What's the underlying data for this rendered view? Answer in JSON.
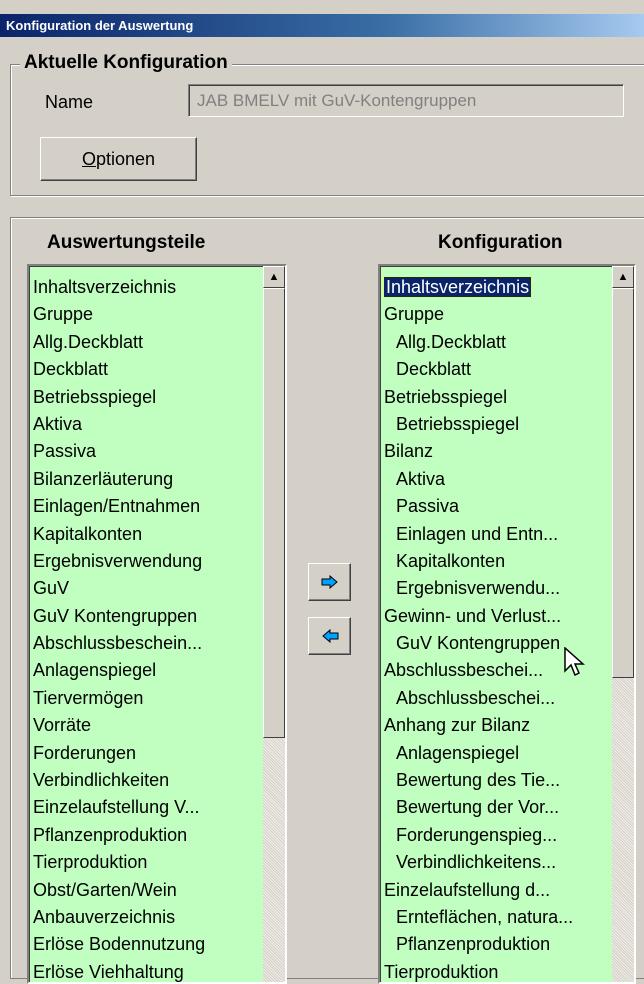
{
  "window": {
    "title": "Konfiguration der Auswertung"
  },
  "current_config": {
    "group_label": "Aktuelle Konfiguration",
    "name_label": "Name",
    "name_value": "JAB BMELV mit  GuV-Kontengruppen",
    "options_button_first": "O",
    "options_button_rest": "ptionen"
  },
  "left_list": {
    "header": "Auswertungsteile",
    "items": [
      "Inhaltsverzeichnis",
      "Gruppe",
      "Allg.Deckblatt",
      "Deckblatt",
      "Betriebsspiegel",
      "Aktiva",
      "Passiva",
      "Bilanzerläuterung",
      "Einlagen/Entnahmen",
      "Kapitalkonten",
      "Ergebnisverwendung",
      "GuV",
      "GuV Kontengruppen",
      "Abschlussbeschein...",
      "Anlagenspiegel",
      "Tiervermögen",
      "Vorräte",
      "Forderungen",
      "Verbindlichkeiten",
      "Einzelaufstellung V...",
      "Pflanzenproduktion",
      "Tierproduktion",
      "Obst/Garten/Wein",
      "Anbauverzeichnis",
      "Erlöse Bodennutzung",
      "Erlöse Viehhaltung"
    ]
  },
  "right_list": {
    "header": "Konfiguration",
    "selected": "Inhaltsverzeichnis",
    "items": [
      "Gruppe",
      "Allg.Deckblatt",
      "Deckblatt",
      "Betriebsspiegel",
      "Betriebsspiegel",
      "Bilanz",
      "Aktiva",
      "Passiva",
      "Einlagen und Entn...",
      "Kapitalkonten",
      "Ergebnisverwendu...",
      "Gewinn- und Verlust...",
      "GuV Kontengruppen",
      "Abschlussbeschei...",
      "Abschlussbeschei...",
      "Anhang zur Bilanz",
      "Anlagenspiegel",
      "Bewertung des Tie...",
      "Bewertung der Vor...",
      "Forderungenspieg...",
      "Verbindlichkeitens...",
      "Einzelaufstellung d...",
      "Ernteflächen, natura...",
      "Pflanzenproduktion",
      "Tierproduktion"
    ]
  },
  "icons": {
    "add": "arrow-right-icon",
    "remove": "arrow-left-icon",
    "scroll_up": "scroll-up-arrow-icon"
  },
  "colors": {
    "list_background": "#c0ffc0",
    "selection": "#0a246a",
    "arrow_icon": "#00a0ff"
  }
}
